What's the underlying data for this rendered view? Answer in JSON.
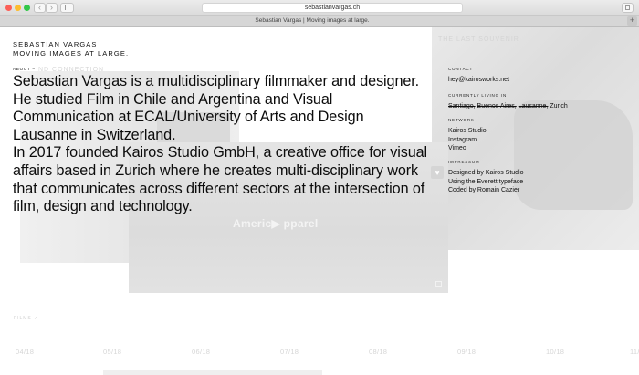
{
  "browser": {
    "address": "sebastianvargas.ch",
    "tab_title": "Sebastian Vargas | Moving images at large.",
    "new_tab": "+",
    "back": "‹",
    "forward": "›"
  },
  "brand": {
    "name": "SEBASTIAN VARGAS",
    "tagline": "MOVING IMAGES AT LARGE."
  },
  "about": {
    "label": "ABOUT –",
    "paragraph_1": "Sebastian Vargas is a multidisciplinary filmmaker and designer. He studied Film in Chile and Argentina and Visual Communication at ECAL/University of Arts and Design Lausanne in Switzerland.",
    "paragraph_2": "In 2017 founded Kairos Studio GmbH, a creative office for visual affairs based in Zurich where he creates multi-disciplinary work that communicates across different sectors at the intersection of film, design and technology."
  },
  "contact": {
    "label": "CONTACT",
    "email": "hey@kairosworks.net"
  },
  "living": {
    "label": "CURRENTLY LIVING IN",
    "past": [
      "Santiago,",
      "Buenos Aires,",
      "Lausanne,"
    ],
    "current": "Zurich"
  },
  "network": {
    "label": "NETWORK",
    "links": [
      "Kairos Studio",
      "Instagram",
      "Vimeo"
    ]
  },
  "impressum": {
    "label": "IMPRESSUM",
    "lines": [
      "Designed by Kairos Studio",
      "Using the Everett typeface",
      "Coded by Romain Cazier"
    ]
  },
  "background": {
    "last_title": "THE LAST SOUVENIR",
    "connection_title": "ND CONNECTION",
    "video_caption": "Americ▶ pparel",
    "films_label": "FILMS ↗",
    "timeline": [
      "04/18",
      "05/18",
      "06/18",
      "07/18",
      "08/18",
      "09/18",
      "10/18",
      "11/"
    ]
  },
  "icons": {
    "heart": "heart-icon",
    "expand": "expand-icon",
    "sidebar": "sidebar-icon",
    "share": "share-icon"
  }
}
